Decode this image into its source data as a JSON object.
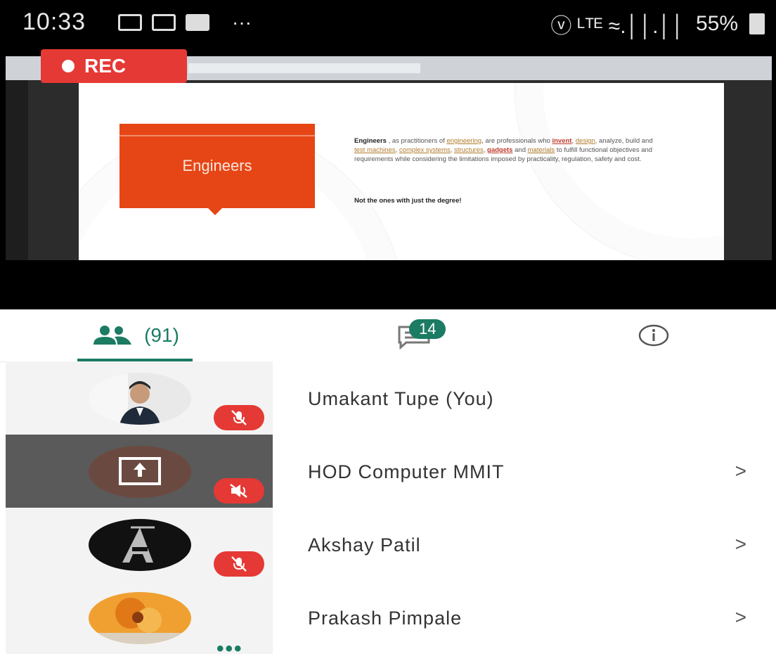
{
  "status_bar": {
    "time": "10:33",
    "more": "···",
    "network": "ⓥ ᴸᵀᴱ ≈.││.││",
    "battery": "55%"
  },
  "recording": {
    "label": "REC"
  },
  "slide": {
    "callout_title": "Engineers",
    "body_parts": [
      {
        "text": "Engineers",
        "style": "bold"
      },
      {
        "text": " , as practitioners of ",
        "style": "plain"
      },
      {
        "text": "engineering",
        "style": "link"
      },
      {
        "text": ", are professionals who ",
        "style": "plain"
      },
      {
        "text": "invent",
        "style": "red"
      },
      {
        "text": ", ",
        "style": "plain"
      },
      {
        "text": "design",
        "style": "link"
      },
      {
        "text": ", analyze, build and ",
        "style": "plain"
      },
      {
        "text": "test machines",
        "style": "link"
      },
      {
        "text": ", ",
        "style": "plain"
      },
      {
        "text": "complex systems",
        "style": "link"
      },
      {
        "text": ", ",
        "style": "plain"
      },
      {
        "text": "structures",
        "style": "link"
      },
      {
        "text": ", ",
        "style": "plain"
      },
      {
        "text": "gadgets",
        "style": "red"
      },
      {
        "text": " and ",
        "style": "plain"
      },
      {
        "text": "materials",
        "style": "link"
      },
      {
        "text": " to fulfill functional objectives and requirements while considering the limitations imposed by practicality, regulation, safety and cost.",
        "style": "plain"
      }
    ],
    "note": "Not the ones with just the degree!"
  },
  "tabs": {
    "people_count": "(91)",
    "chat_badge": "14"
  },
  "participants": [
    {
      "name": "Umakant Tupe (You)",
      "avatar": "photo-man",
      "status_icon": "mic-off-icon",
      "selected": false,
      "has_chevron": false
    },
    {
      "name": "HOD Computer MMIT",
      "avatar": "screen-share",
      "status_icon": "mic-off-icon",
      "selected": true,
      "has_chevron": true
    },
    {
      "name": "Akshay Patil",
      "avatar": "letter-a-logo",
      "status_icon": "mic-off-icon",
      "selected": false,
      "has_chevron": true
    },
    {
      "name": "Prakash Pimpale",
      "avatar": "photo-flower",
      "status_icon": "more-dots-icon",
      "selected": false,
      "has_chevron": true
    }
  ],
  "chevron": ">",
  "colors": {
    "accent": "#1b7b63",
    "rec": "#e53935",
    "callout": "#e64616"
  }
}
